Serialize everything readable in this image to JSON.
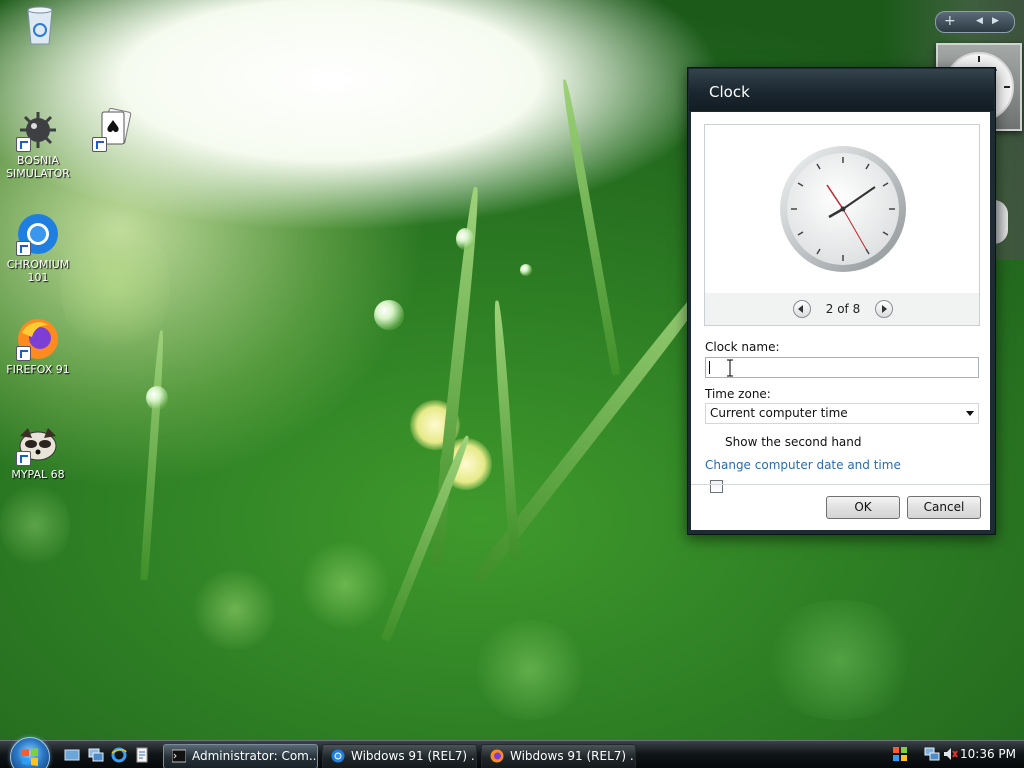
{
  "desktop": {
    "icons": [
      {
        "label": ""
      },
      {
        "label": "BOSNIA SIMULATOR"
      },
      {
        "label": ""
      },
      {
        "label": "CHROMIUM 101"
      },
      {
        "label": "FIREFOX 91"
      },
      {
        "label": "MYPAL 68"
      }
    ]
  },
  "sidebar_controls": {
    "add": "+",
    "prev": "◀",
    "next": "▶"
  },
  "dialog": {
    "title": "Clock",
    "pager": "2 of 8",
    "clock_name_label": "Clock name:",
    "clock_name_value": "",
    "time_zone_label": "Time zone:",
    "time_zone_value": "Current computer time",
    "second_hand_label": "Show the second hand",
    "second_hand_checked": false,
    "change_link": "Change computer date and time",
    "ok_label": "OK",
    "cancel_label": "Cancel"
  },
  "taskbar": {
    "tasks": [
      {
        "label": "Administrator: Com...",
        "icon": "cmd-icon"
      },
      {
        "label": "Wibdows 91 (REL7) ...",
        "icon": "chromium-icon"
      },
      {
        "label": "Wibdows 91 (REL7) ...",
        "icon": "firefox-icon"
      }
    ],
    "time": "10:36 PM"
  },
  "colors": {
    "link": "#2a6bb3",
    "title_bar": "#1b2730",
    "wallpaper_green": "#2d7d24"
  }
}
